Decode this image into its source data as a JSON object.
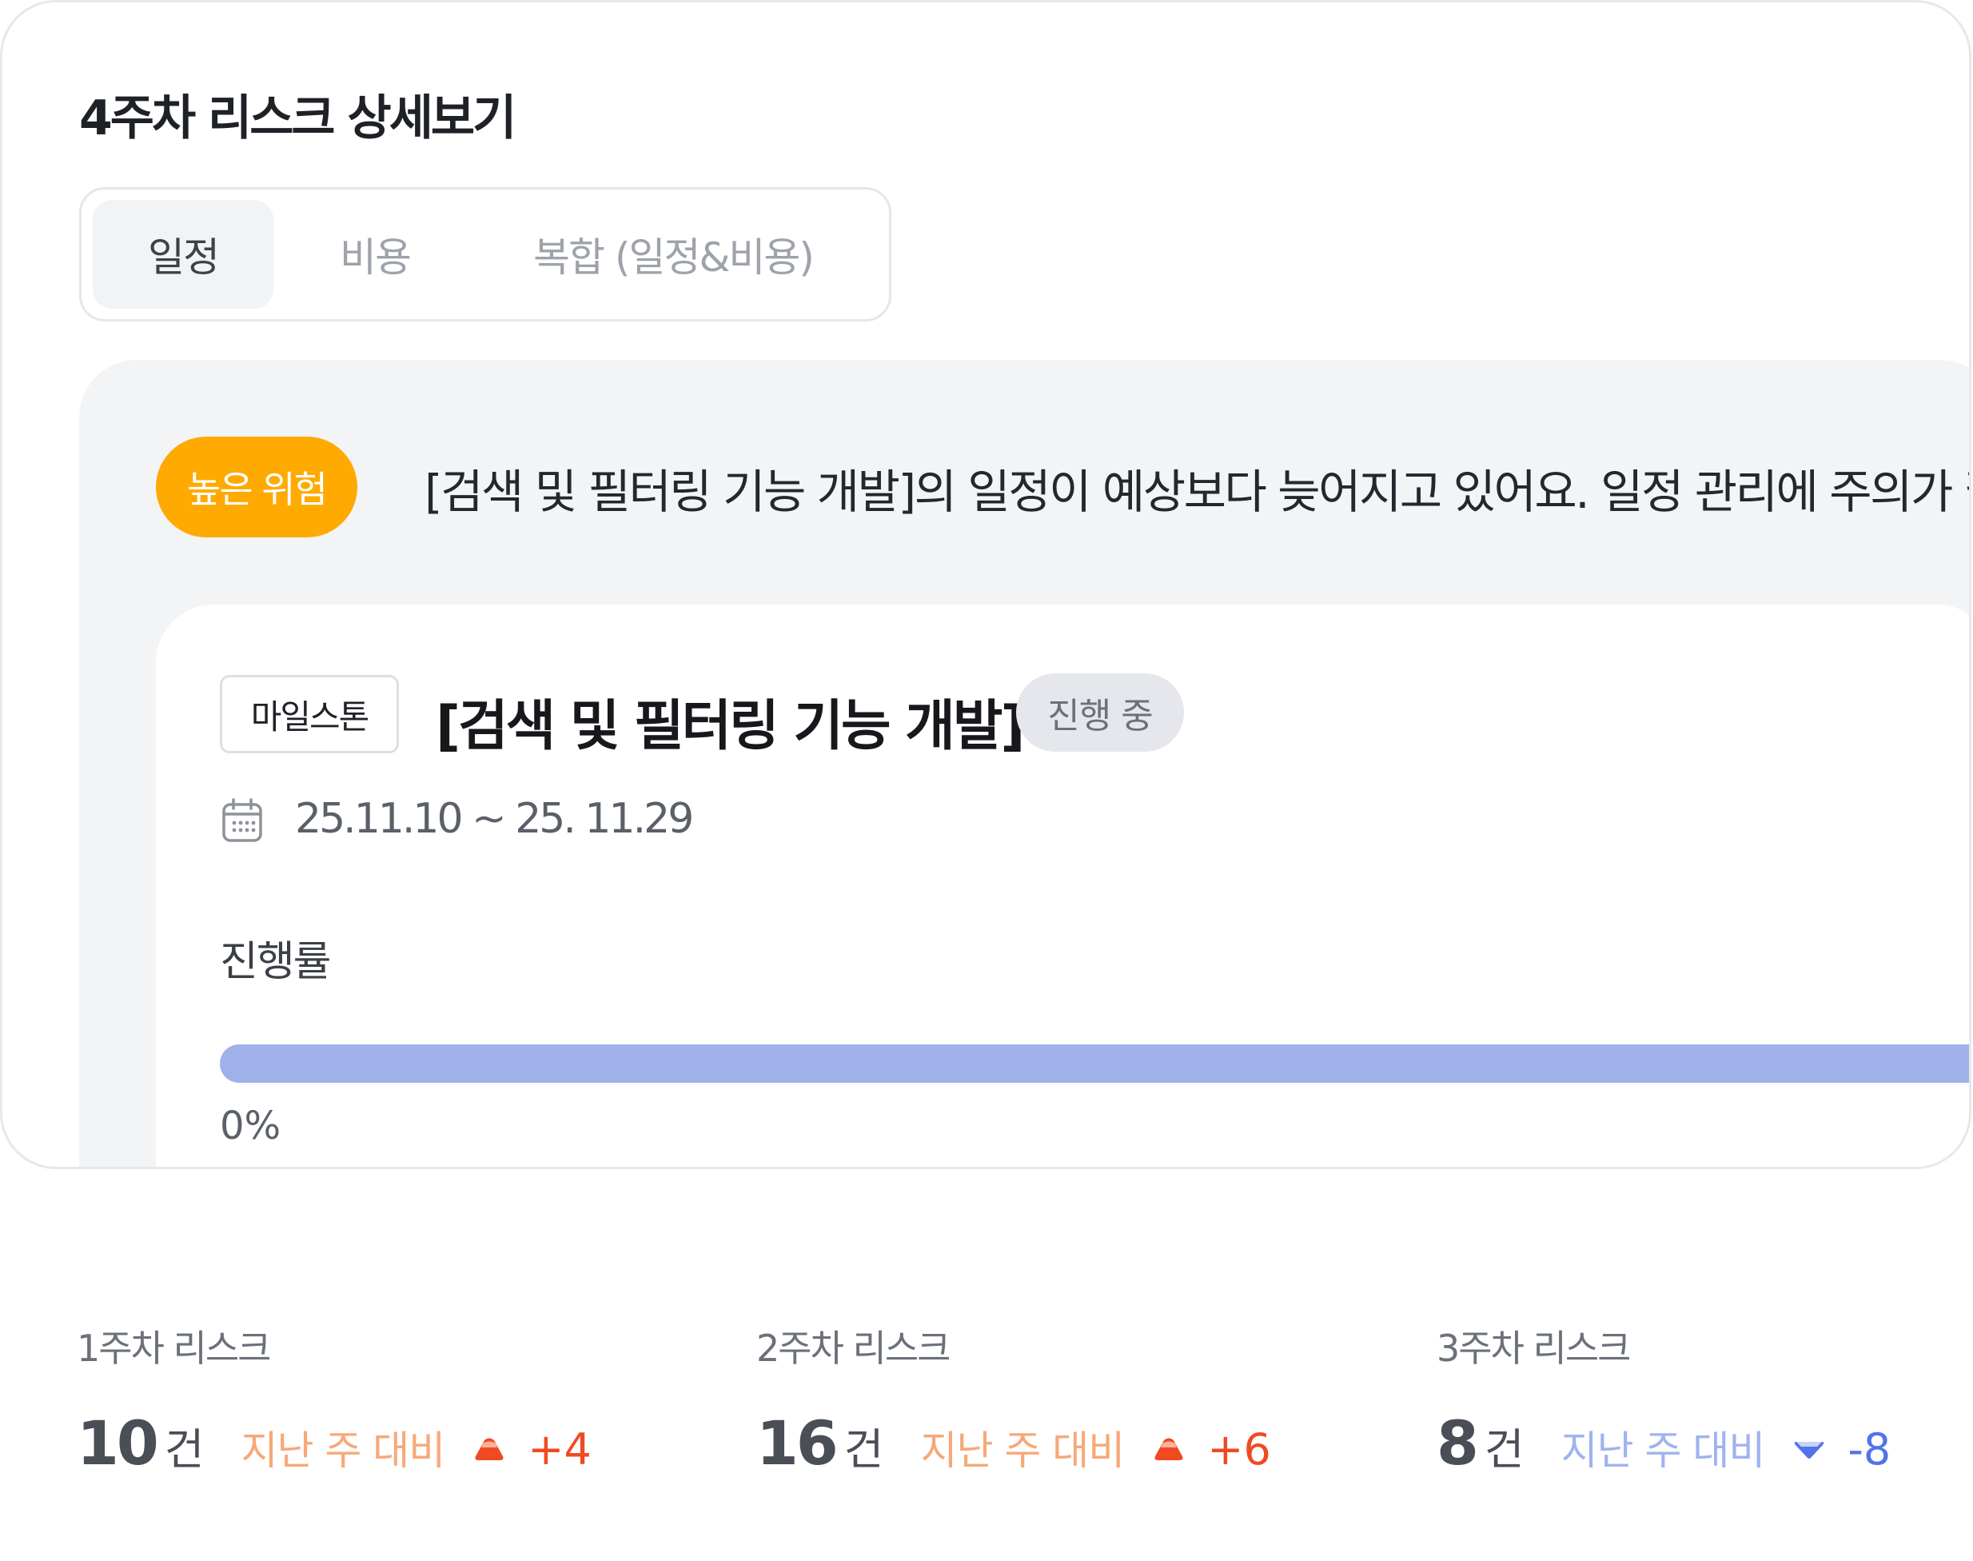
{
  "page": {
    "title": "4주차 리스크 상세보기"
  },
  "tabs": [
    {
      "label": "일정",
      "active": true
    },
    {
      "label": "비용",
      "active": false
    },
    {
      "label": "복합 (일정&비용)",
      "active": false
    }
  ],
  "risk": {
    "level_label": "높은 위험",
    "level_color": "#ffaa00",
    "message": "[검색 및 필터링 기능 개발]의 일정이 예상보다 늦어지고 있어요. 일정 관리에 주의가 필요해요."
  },
  "milestone": {
    "tag": "마일스톤",
    "title": "[검색 및 필터링 기능 개발]",
    "status": "진행 중",
    "date_range": "25.11.10 ~ 25. 11.29",
    "calendar_icon": "calendar-icon",
    "progress_label": "진행률",
    "progress_value": 0,
    "progress_text": "0%",
    "progress_color": "#a0b1ea"
  },
  "weekly": [
    {
      "label": "1주차 리스크",
      "count": "10",
      "unit": "건",
      "compare": "지난 주 대비",
      "direction": "up",
      "delta": "+4"
    },
    {
      "label": "2주차 리스크",
      "count": "16",
      "unit": "건",
      "compare": "지난 주 대비",
      "direction": "up",
      "delta": "+6"
    },
    {
      "label": "3주차 리스크",
      "count": "8",
      "unit": "건",
      "compare": "지난 주 대비",
      "direction": "down",
      "delta": "-8"
    }
  ],
  "colors": {
    "up": "#f04a23",
    "down": "#5273ea"
  }
}
